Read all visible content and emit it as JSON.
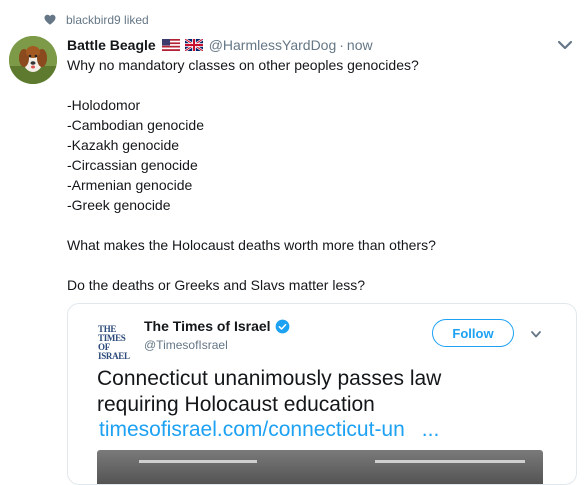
{
  "activity": {
    "liked_text": "blackbird9 liked"
  },
  "tweet": {
    "display_name": "Battle Beagle",
    "handle": "@HarmlessYardDog",
    "separator": "·",
    "time": "now",
    "lines": [
      "Why no mandatory classes on other peoples genocides?",
      "",
      "-Holodomor",
      "-Cambodian genocide",
      "-Kazakh genocide",
      "-Circassian genocide",
      "-Armenian genocide",
      "-Greek genocide",
      "",
      "What makes the Holocaust deaths worth more than others?",
      "",
      "Do the deaths or Greeks and Slavs matter less?"
    ]
  },
  "embed": {
    "logo_line1": "THE TIMES",
    "logo_line2": "OF ISRAEL",
    "account_name": "The Times of Israel",
    "account_handle": "@TimesofIsrael",
    "follow_label": "Follow",
    "headline_line1": "Connecticut unanimously passes law",
    "headline_line2": "requiring Holocaust education",
    "link_text": "timesofisrael.com/connecticut-un",
    "link_ellipsis": "..."
  },
  "colors": {
    "accent": "#1da1f2",
    "muted": "#657786",
    "text": "#14171a",
    "border": "#e1e8ed"
  },
  "icons": [
    "heart-icon",
    "us-flag-icon",
    "uk-flag-icon",
    "chevron-down-icon",
    "verified-icon"
  ]
}
